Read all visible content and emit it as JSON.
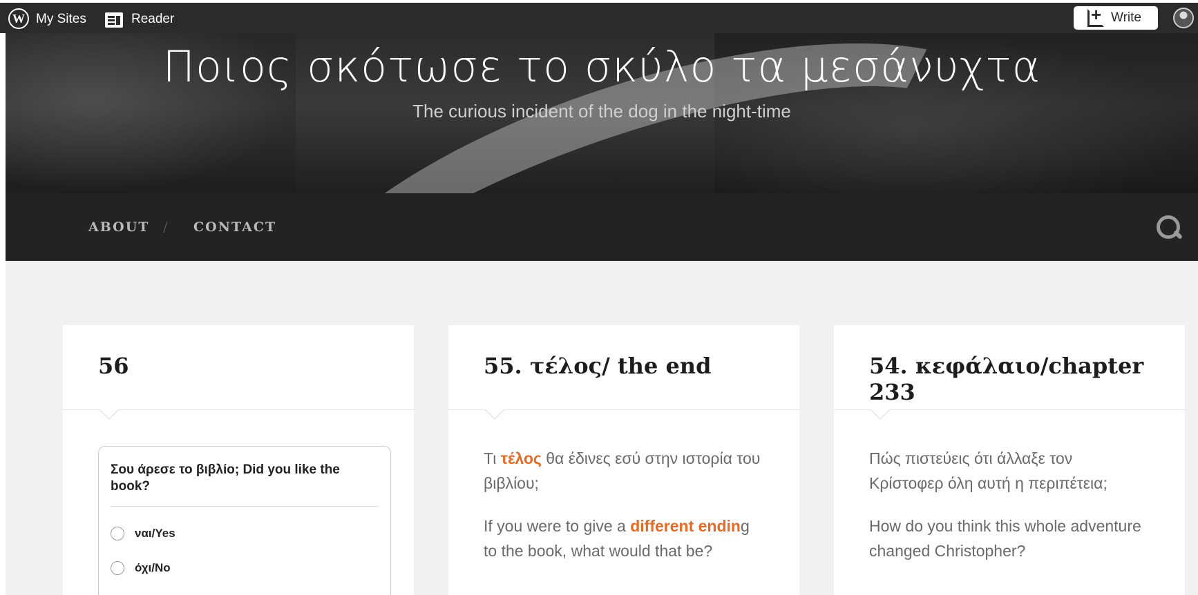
{
  "adminbar": {
    "logo_icon": "wordpress-logo",
    "my_sites": "My Sites",
    "reader": "Reader",
    "write": "Write"
  },
  "header": {
    "title": "Ποιος σκότωσε το σκύλο τα μεσάνυχτα",
    "description": "The curious incident of the dog in the night-time"
  },
  "nav": {
    "items": [
      {
        "label": "ABOUT"
      },
      {
        "label": "CONTACT"
      }
    ],
    "separator": "/"
  },
  "posts": [
    {
      "title": "56",
      "poll": {
        "question": "Σου άρεσε το βιβλίο; Did you like the book?",
        "options": [
          "ναι/Yes",
          "όχι/No"
        ]
      }
    },
    {
      "title": "55. τέλος/ the end",
      "p1_before": "Τι ",
      "p1_highlight": "τέλος",
      "p1_after": " θα έδινες εσύ στην ιστορία του βιβλίου;",
      "p2_before": "If you were to give a ",
      "p2_highlight": "different endin",
      "p2_after": "g to the book, what would that be?"
    },
    {
      "title": "54. κεφάλαιο/chapter 233",
      "p1": "Πώς πιστεύεις ότι άλλαξε τον Κρίστοφερ όλη αυτή η περιπέτεια;",
      "p2": "How do you think this whole adventure changed Christopher?"
    }
  ],
  "colors": {
    "accent": "#e86a21",
    "adminbar_bg": "#2b2b2b",
    "nav_bg": "#232323",
    "content_bg": "#f1f1f1"
  }
}
